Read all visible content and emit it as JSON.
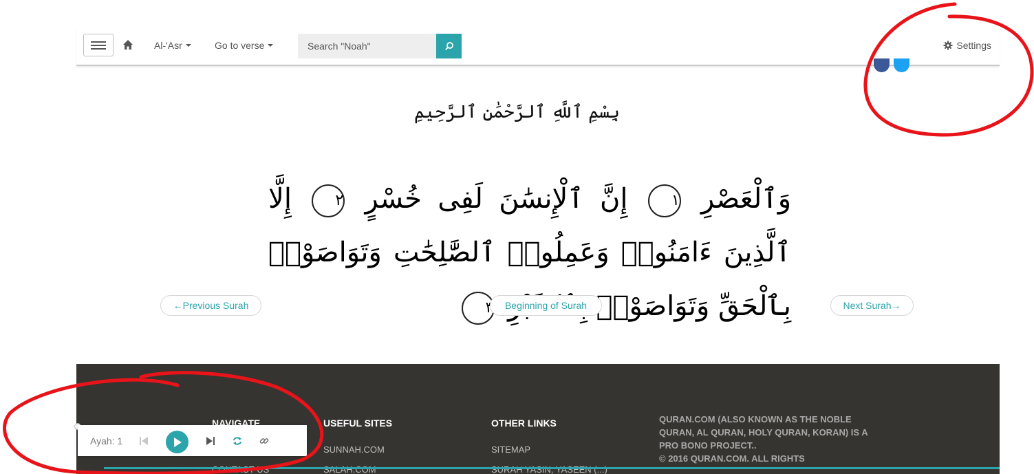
{
  "navbar": {
    "surah_menu": "Al-'Asr",
    "verse_menu": "Go to verse",
    "search": {
      "placeholder": "Search \"Noah\""
    },
    "settings_label": "Settings"
  },
  "bismillah": "بِسْمِ ٱللَّهِ ٱلرَّحْمَٰنِ ٱلرَّحِيمِ",
  "verses": [
    {
      "text": "وَٱلْعَصْرِ",
      "number": "١"
    },
    {
      "text": "إِنَّ ٱلْإِنسَٰنَ لَفِى خُسْرٍ",
      "number": "٢"
    },
    {
      "text": "إِلَّا ٱلَّذِينَ ءَامَنُوا۟ وَعَمِلُوا۟ ٱلصَّٰلِحَٰتِ وَتَوَاصَوْا۟ بِٱلْحَقِّ وَتَوَاصَوْا۟ بِٱلصَّبْرِ",
      "number": "٣"
    }
  ],
  "pager": {
    "prev": "←Previous Surah",
    "beginning": "Beginning of Surah",
    "next": "Next Surah→"
  },
  "footer": {
    "navigate": {
      "heading": "NAVIGATE",
      "links": [
        "CONTACT US"
      ]
    },
    "useful_sites": {
      "heading": "USEFUL SITES",
      "links": [
        "SUNNAH.COM",
        "SALAH.COM"
      ]
    },
    "other_links": {
      "heading": "OTHER LINKS",
      "links": [
        "SITEMAP",
        "SURAH YASIN, YASEEN (...)"
      ]
    },
    "about": "QURAN.COM (ALSO KNOWN AS THE NOBLE QURAN, AL QURAN, HOLY QURAN, KORAN) IS A PRO BONO PROJECT..",
    "copyright": "© 2016 QURAN.COM. ALL RIGHTS"
  },
  "player": {
    "ayah_label": "Ayah: 1"
  },
  "colors": {
    "accent": "#2ca4ab",
    "footer_bg": "#363430",
    "annotation": "#e8141a"
  }
}
